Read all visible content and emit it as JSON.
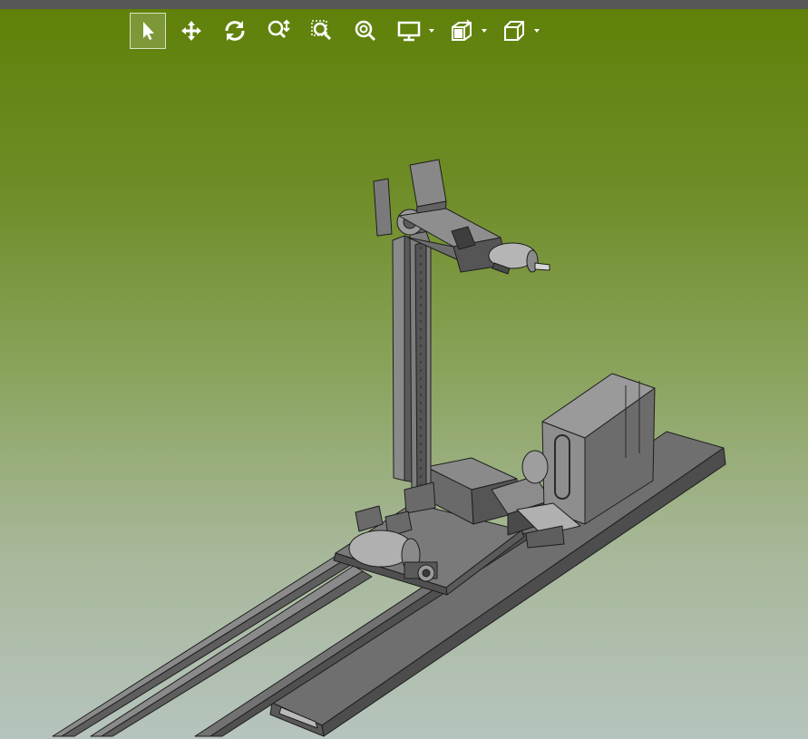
{
  "viewport": {
    "background_top": "#5f8008",
    "background_bottom": "#b6c4bd",
    "model_color": "#6b6b6b",
    "edge_color": "#1e1e1e"
  },
  "toolbar": {
    "buttons": [
      {
        "icon": "select-arrow-icon",
        "active": true
      },
      {
        "icon": "pan-move-icon",
        "active": false
      },
      {
        "icon": "rotate-icon",
        "active": false
      },
      {
        "icon": "zoom-icon",
        "active": false
      },
      {
        "icon": "zoom-window-icon",
        "active": false
      },
      {
        "icon": "zoom-fit-icon",
        "active": false
      },
      {
        "icon": "display-mode-icon",
        "dropdown": true
      },
      {
        "icon": "section-view-icon",
        "dropdown": true
      },
      {
        "icon": "view-cube-icon",
        "dropdown": true
      }
    ]
  }
}
